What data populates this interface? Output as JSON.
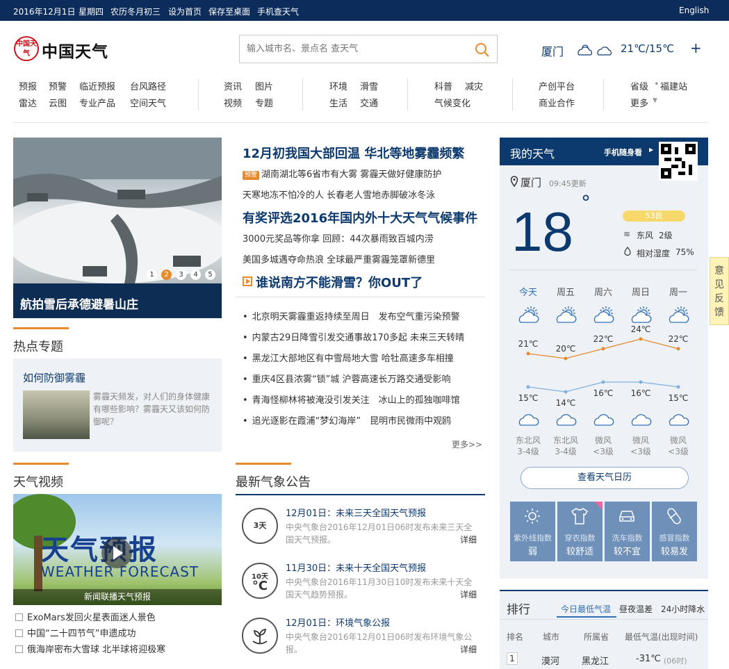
{
  "topbar": {
    "date": "2016年12月1日",
    "weekday": "星期四",
    "lunar": "农历冬月初三",
    "set_home": "设为首页",
    "save_desktop": "保存至桌面",
    "mobile": "手机查天气",
    "english": "English"
  },
  "header": {
    "logo_text": "中国天气",
    "logo_seal": "中国天气",
    "search_placeholder": "输入城市名、景点名 查天气",
    "city": "厦门",
    "temp": "21℃/15℃",
    "plus": "+"
  },
  "nav": {
    "g1": [
      "预报",
      "预警",
      "临近预报",
      "台风路径",
      "雷达",
      "云图",
      "专业产品",
      "空间天气"
    ],
    "g2": [
      "资讯",
      "图片",
      "视频",
      "专题"
    ],
    "g3": [
      "环境",
      "滑雪",
      "生活",
      "交通"
    ],
    "g4": [
      "科普",
      "减灾",
      "气候变化"
    ],
    "g5": [
      "产创平台",
      "商业合作"
    ],
    "g6": [
      "省级",
      "福建站",
      "更多"
    ]
  },
  "slider": {
    "caption": "航拍雪后承德避暑山庄",
    "dots": [
      "1",
      "2",
      "3",
      "4",
      "5"
    ]
  },
  "news": {
    "h1": "12月初我国大部回温 华北等地雾霾频繁",
    "badge": "预警",
    "s1": "湖南湖北等6省市有大雾 雾霾天做好健康防护",
    "s2": "天寒地冻不怕冷的人 长春老人雪地赤脚破冰冬泳",
    "h2": "有奖评选2016年国内外十大天气气候事件",
    "s3": "3000元奖品等你拿 回顾：44次暴雨致百城内涝",
    "s4": "美国多城遇夺命热浪 全球最严重雾霾笼罩新德里",
    "h3": "谁说南方不能滑雪？你OUT了",
    "list": [
      "北京明天雾霾重返持续至周日　发布空气重污染预警",
      "内蒙古29日降雪引发交通事故170多起 未来三天转晴",
      "黑龙江大部地区有中雪局地大雪 哈牡高速多车相撞",
      "重庆4区县浓雾“锁”城 沪蓉高速长万路交通受影响",
      "青海怪柳林将被淹没引发关注　冰山上的孤独咖啡馆",
      "追光逐影在霞浦“梦幻海岸”　昆明市民微雨中观鸥"
    ],
    "more": "更多>>"
  },
  "hot": {
    "title": "热点专题",
    "topic": "如何防御雾霾",
    "desc": "雾霾天频发，对人们的身体健康有哪些影响？雾霾天又该如何防御呢？"
  },
  "myweather": {
    "title": "我的天气",
    "mobile": "手机随身看",
    "city": "厦门",
    "update": "09:45更新",
    "temp": "18",
    "deg": "°",
    "aqi": "53良",
    "wind": "东风",
    "wind_level": "2级",
    "humidity_label": "相对湿度",
    "humidity": "75%",
    "days": [
      "今天",
      "周五",
      "周六",
      "周日",
      "周一"
    ],
    "highs": [
      "21℃",
      "20℃",
      "22℃",
      "24℃",
      "22℃"
    ],
    "lows": [
      "15℃",
      "14℃",
      "16℃",
      "16℃",
      "15℃"
    ],
    "high_values": [
      21,
      20,
      22,
      24,
      22
    ],
    "low_values": [
      15,
      14,
      16,
      16,
      15
    ],
    "winds": [
      [
        "东北风",
        "3-4级"
      ],
      [
        "东北风",
        "3-4级"
      ],
      [
        "微风",
        "<3级"
      ],
      [
        "微风",
        "<3级"
      ],
      [
        "微风",
        "<3级"
      ]
    ],
    "calendar_btn": "查看天气日历",
    "indexes": [
      {
        "label": "紫外线指数",
        "value": "弱"
      },
      {
        "label": "穿衣指数",
        "value": "较舒适"
      },
      {
        "label": "洗车指数",
        "value": "较不宜"
      },
      {
        "label": "感冒指数",
        "value": "较易发"
      }
    ],
    "colors": {
      "high": "#e58a2d",
      "low": "#7fb0e0"
    }
  },
  "rank": {
    "title": "排行",
    "tabs": [
      "今日最低气温",
      "昼夜温差",
      "24小时降水"
    ],
    "cols": [
      "排名",
      "城市",
      "所属省",
      "最低气温(出现时间)"
    ],
    "row": {
      "n": "1",
      "city": "漠河",
      "prov": "黑龙江",
      "temp": "-31℃",
      "time": "(06时)"
    }
  },
  "video": {
    "title": "天气视频",
    "banner_cn": "天气预报",
    "banner_en": "WEATHER FORECAST",
    "caption": "新闻联播天气预报",
    "list": [
      "ExoMars发回火星表面迷人景色",
      "中国“二十四节气”申遗成功",
      "俄海岸密布大雪球 北半球将迎极寒"
    ]
  },
  "bulletin": {
    "title": "最新气象公告",
    "items": [
      {
        "icon": "3天",
        "title": "12月01日：未来三天全国天气预报",
        "desc": "中央气象台2016年12月01日06时发布未来三天全国天气预报。",
        "more": "详细"
      },
      {
        "icon": "10天",
        "title": "11月30日：未来十天全国天气预报",
        "desc": "中央气象台2016年11月30日10时发布未来十天全国天气趋势预报。",
        "more": "详细"
      },
      {
        "icon": "",
        "title": "12月01日：环境气象公报",
        "desc": "中央气象台2016年12月01日06时发布环境气象公报。",
        "more": "详细"
      }
    ]
  },
  "feedback": "意见反馈"
}
